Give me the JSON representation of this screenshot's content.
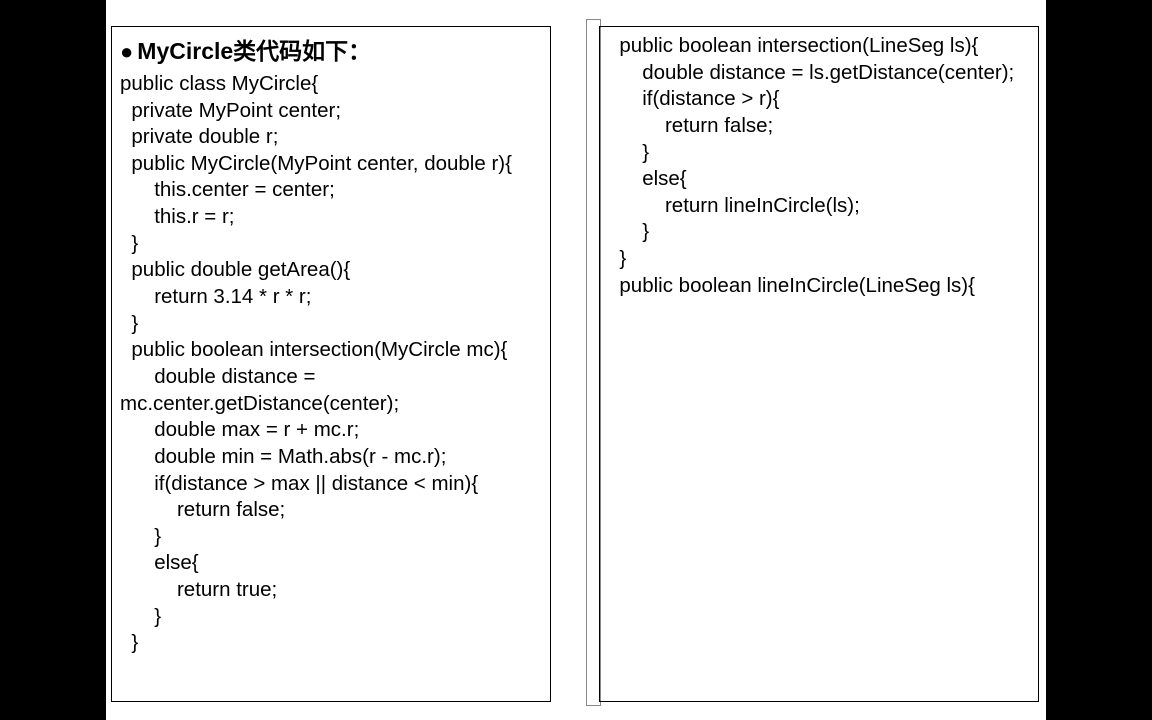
{
  "heading": "MyCircle类代码如下：",
  "left_code": "public class MyCircle{\n  private MyPoint center;\n  private double r;\n  public MyCircle(MyPoint center, double r){\n      this.center = center;\n      this.r = r;\n  }\n  public double getArea(){\n      return 3.14 * r * r;\n  }\n  public boolean intersection(MyCircle mc){\n      double distance = mc.center.getDistance(center);\n      double max = r + mc.r;\n      double min = Math.abs(r - mc.r);\n      if(distance > max || distance < min){\n          return false;\n      }\n      else{\n          return true;\n      }\n  }",
  "right_code": "  public boolean intersection(LineSeg ls){\n      double distance = ls.getDistance(center);\n      if(distance > r){\n          return false;\n      }\n      else{\n          return lineInCircle(ls);\n      }\n  }\n  public boolean lineInCircle(LineSeg ls){"
}
